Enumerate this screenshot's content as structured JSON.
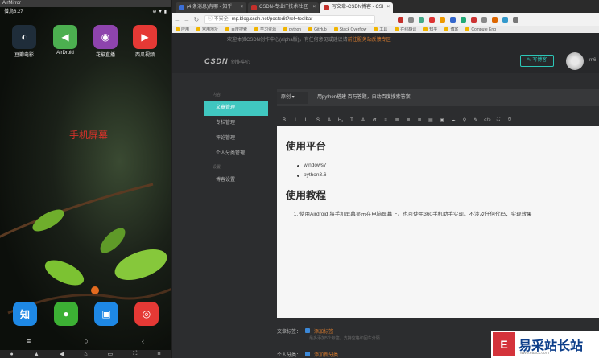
{
  "airmirror": {
    "title": "AirMirror",
    "status_left": "僧鳥8:27",
    "status_right": "⊕ ▼ ▮",
    "caption": "手机屏幕",
    "apps": [
      {
        "name": "豆瓣电影",
        "color": "#1f2d3a",
        "glyph": "◐"
      },
      {
        "name": "AirDroid",
        "color": "#4caf50",
        "glyph": "◀"
      },
      {
        "name": "花椒直播",
        "color": "#8e44ad",
        "glyph": "◉"
      },
      {
        "name": "西瓜视频",
        "color": "#e53935",
        "glyph": "▶"
      }
    ],
    "dock": [
      {
        "name": "知",
        "color": "#1e88e5",
        "glyph": "知"
      },
      {
        "name": "wechat",
        "color": "#3cb034",
        "glyph": "●"
      },
      {
        "name": "files",
        "color": "#1e88e5",
        "glyph": "▣"
      },
      {
        "name": "chrome",
        "color": "#e53935",
        "glyph": "◎"
      }
    ],
    "nav": [
      "≡",
      "○",
      "‹"
    ],
    "bottom": [
      "●",
      "▲",
      "◀",
      "⌂",
      "▭",
      "⛶",
      "≡"
    ]
  },
  "browser": {
    "tabs": [
      {
        "label": "(4 条消息)有哪 - 知乎",
        "active": false
      },
      {
        "label": "CSDN-专业IT技术社区",
        "active": false
      },
      {
        "label": "写文章-CSDN博客 - CSI",
        "active": true
      }
    ],
    "insecure": "ⓘ 不安全",
    "url": "mp.blog.csdn.net/postedit?ref=toolbar",
    "bookmarks": [
      "应用",
      "常用地址",
      "百度搜索",
      "学习资源",
      "python",
      "GitHub",
      "Stack Overflow",
      "工具",
      "在线翻译",
      "知乎",
      "博客",
      "Compute Eng"
    ]
  },
  "page": {
    "notice_text": "欢迎体验CSDN创作中心(alpha版)，有任何意见或建议请",
    "notice_link": "前往服务站反馈专区",
    "logo": "CSDN",
    "logo_sub": "创作中心",
    "write_button": "✎ 写博客",
    "avatar_name": "m6",
    "sidebar": [
      {
        "type": "section",
        "label": "内容"
      },
      {
        "type": "item",
        "label": "文章管理",
        "active": true
      },
      {
        "type": "item",
        "label": "专栏管理",
        "active": false
      },
      {
        "type": "item",
        "label": "评论管理",
        "active": false
      },
      {
        "type": "item",
        "label": "个人分类管理",
        "active": false
      },
      {
        "type": "section",
        "label": "设置"
      },
      {
        "type": "item",
        "label": "博客设置",
        "active": false
      }
    ],
    "article_type": "原创",
    "title_value": "用python搭建 百万答题，自动百度搜索答案",
    "tools": [
      "B",
      "I",
      "U",
      "S",
      "A",
      "H₁",
      "T",
      "A",
      "↺",
      "≡",
      "≣",
      "≣",
      "≣",
      "▤",
      "▣",
      "☁",
      "⚲",
      "✎",
      "</>",
      "⛶",
      "⏱"
    ],
    "doc": {
      "h_platform": "使用平台",
      "platform_items": [
        "windows7",
        "python3.6"
      ],
      "h_tutorial": "使用教程",
      "tutorial_items": [
        "使用Airdroid 将手机屏幕显示在电脑屏幕上。也可使用360手机助手实现。不涉及任何代码，实现效果"
      ]
    },
    "tags_label": "文章标签：",
    "tags_add": "添加标签",
    "tags_hint": "最多添加5个标签，支持空格和回车分隔",
    "category_label": "个人分类：",
    "category_add": "添加新分类"
  },
  "watermark": {
    "text": "易采站长站",
    "sub": "www.easck.com"
  }
}
